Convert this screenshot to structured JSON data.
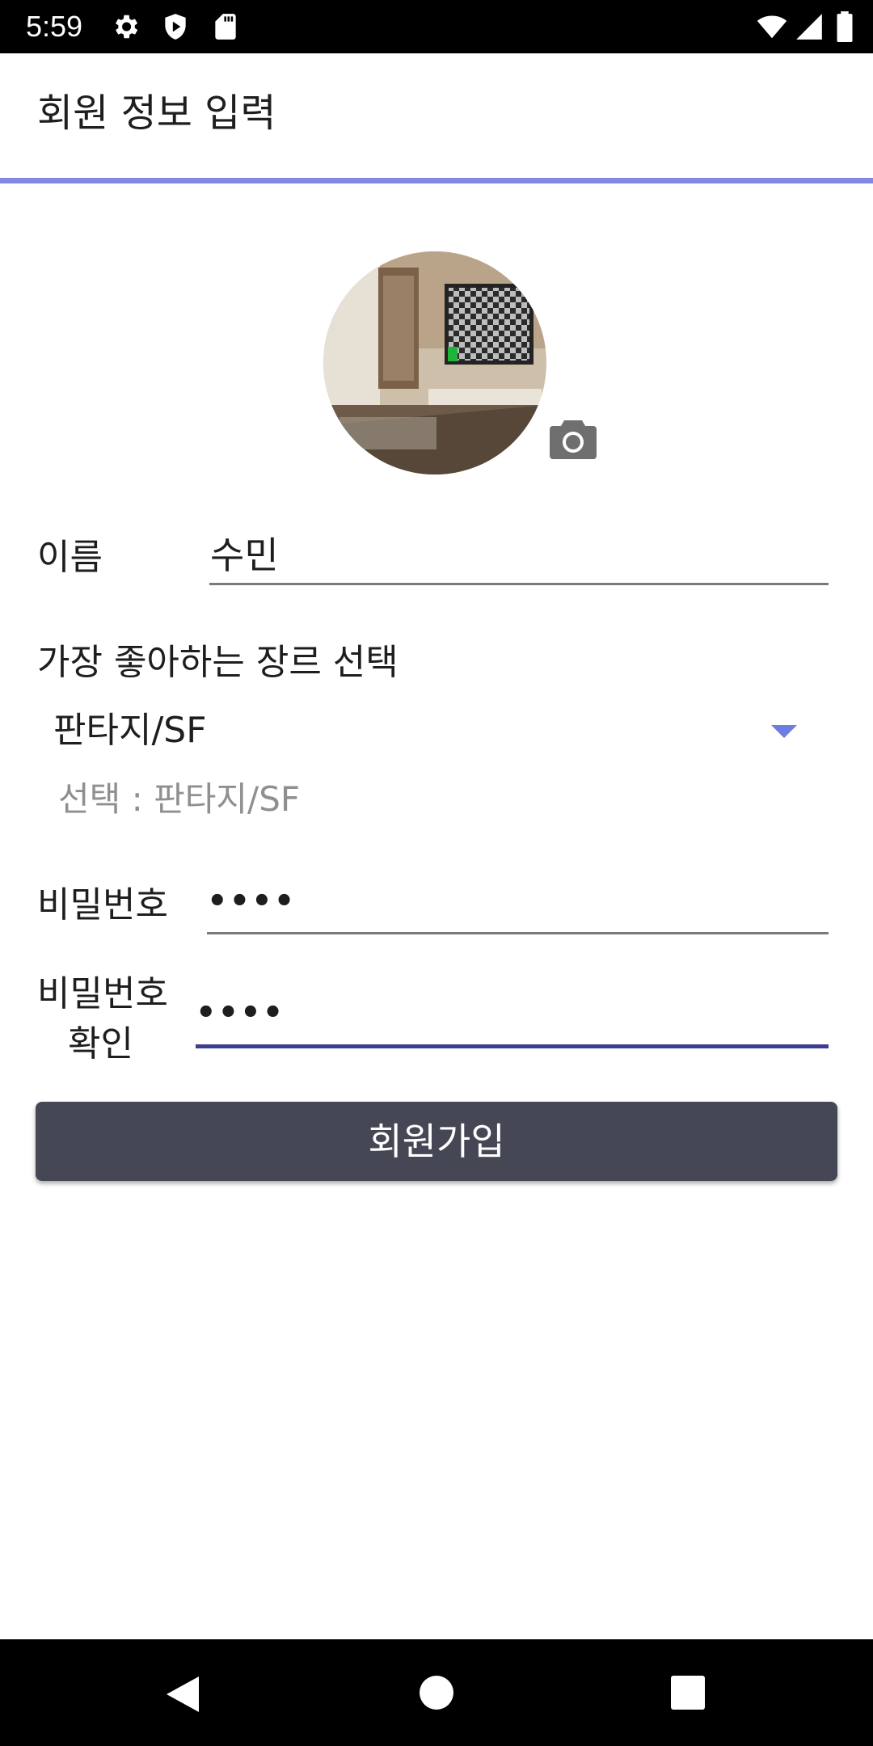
{
  "status_bar": {
    "time": "5:59",
    "left_icons": [
      "gear-icon",
      "shield-play-icon",
      "sd-card-icon"
    ],
    "right_icons": [
      "wifi-icon",
      "signal-icon",
      "battery-icon"
    ]
  },
  "app_bar": {
    "title": "회원 정보 입력",
    "accent_color": "#8189e3"
  },
  "profile": {
    "camera_icon": "camera-icon"
  },
  "form": {
    "name_label": "이름",
    "name_value": "수민",
    "genre_label": "가장 좋아하는 장르 선택",
    "genre_selected": "판타지/SF",
    "genre_selection_text": "선택 : 판타지/SF",
    "password_label": "비밀번호",
    "password_value": "••••",
    "password_confirm_label_line1": "비밀번호",
    "password_confirm_label_line2": "확인",
    "password_confirm_value": "••••",
    "focus_color": "#3b3f8f"
  },
  "signup_button": {
    "label": "회원가입",
    "color": "#454755"
  },
  "nav_bar": {
    "icons": [
      "back-icon",
      "home-icon",
      "recents-icon"
    ]
  }
}
